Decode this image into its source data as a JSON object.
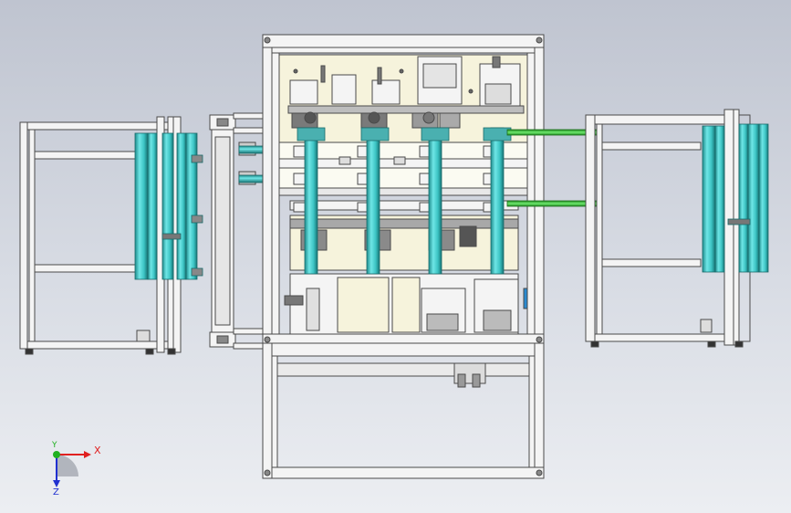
{
  "viewport": {
    "background_top": "#bfc4d0",
    "background_bottom": "#eceef2"
  },
  "model": {
    "frame_color": "#f4f4f4",
    "frame_edge": "#4a4a4a",
    "cylinder_color": "#40c8c8",
    "cylinder_edge": "#1a6a6a",
    "green_rod_color": "#3ec83e",
    "beige_panel_color": "#f6f3dc",
    "bolt_color": "#6a6a6a"
  },
  "triad": {
    "x_label": "X",
    "y_label": "Y",
    "z_label": "Z",
    "x_color": "#e02020",
    "y_color": "#20b020",
    "z_color": "#2030d0"
  }
}
